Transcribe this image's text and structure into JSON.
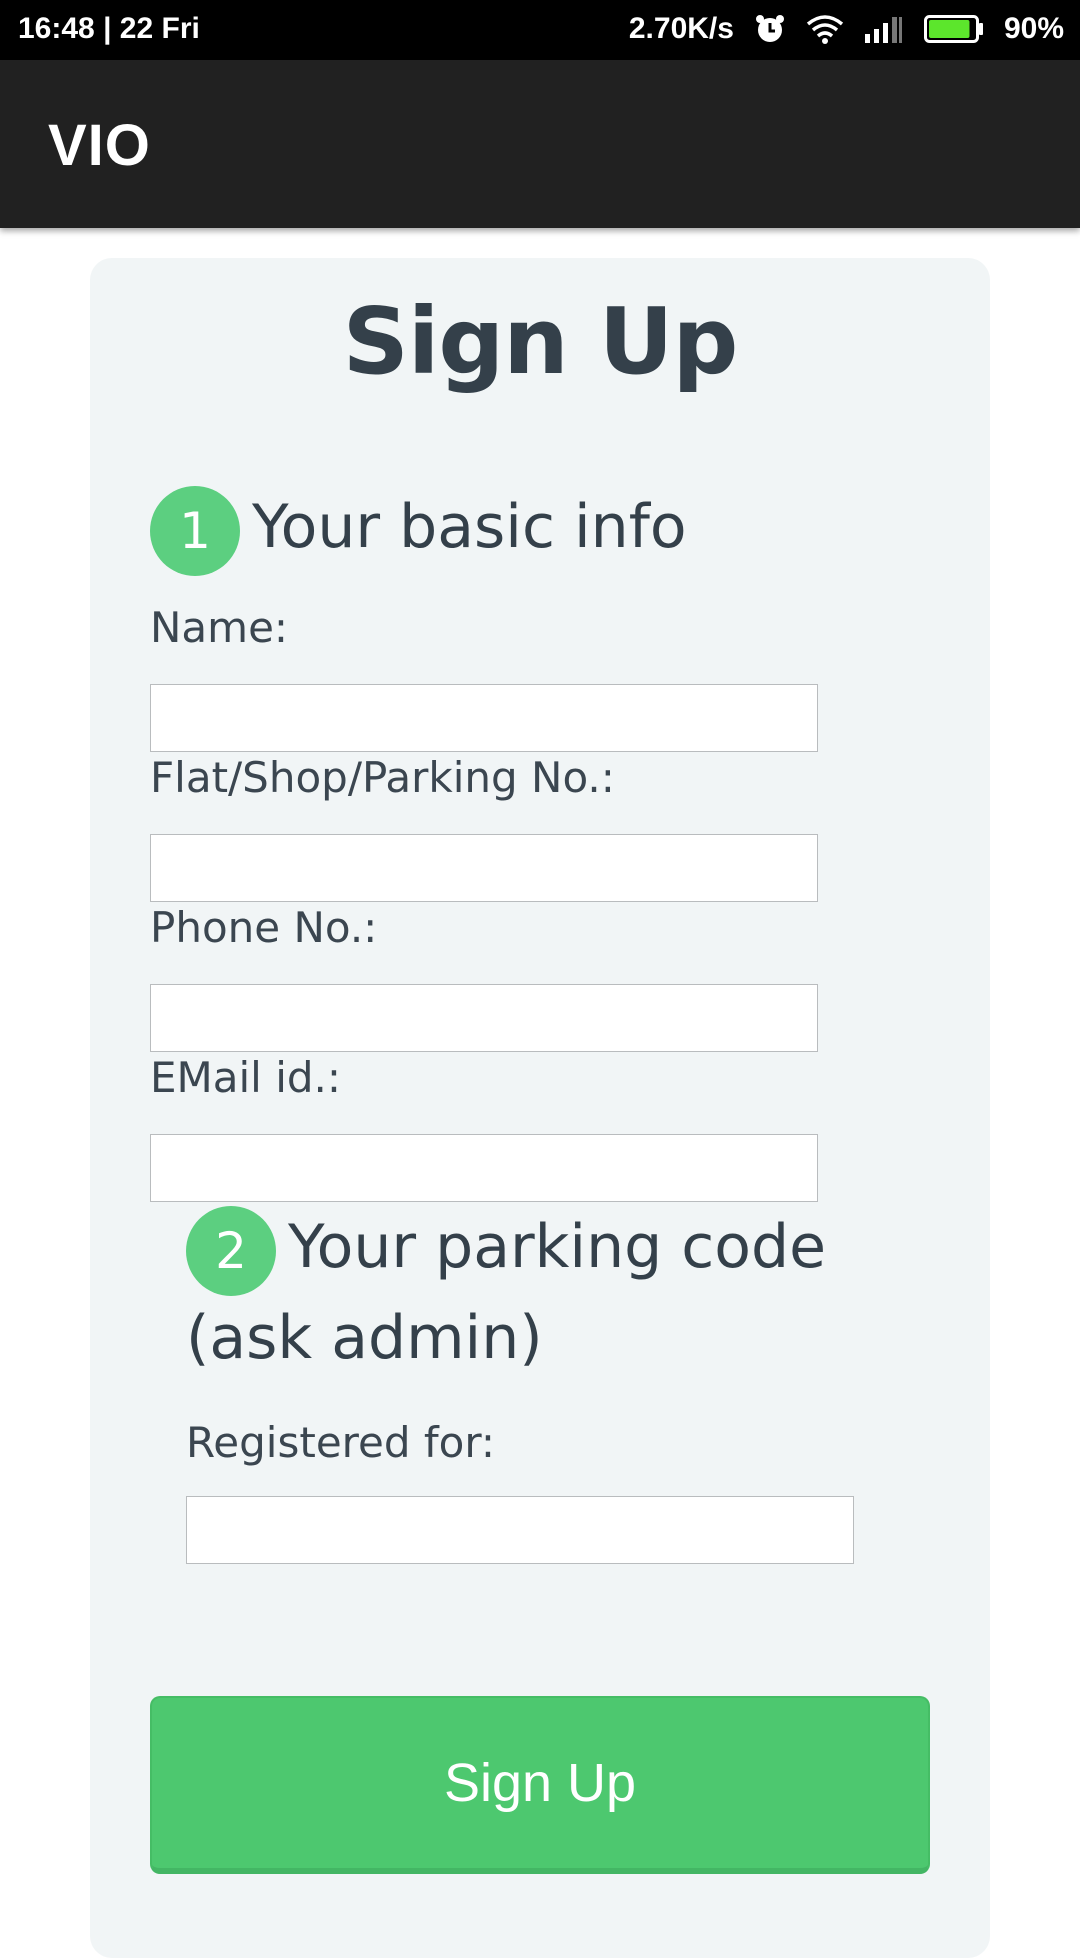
{
  "status_bar": {
    "time_date": "16:48  |  22 Fri",
    "network_speed": "2.70K/s",
    "battery_percent": "90%",
    "battery_level": 0.9,
    "icons": [
      "alarm-icon",
      "wifi-icon",
      "signal-icon",
      "battery-icon"
    ]
  },
  "app_bar": {
    "title": "VIO"
  },
  "form": {
    "title": "Sign Up",
    "step1": {
      "number": "1",
      "title": "Your basic info"
    },
    "fields": [
      {
        "label": "Name:",
        "value": "",
        "placeholder": ""
      },
      {
        "label": "Flat/Shop/Parking No.:",
        "value": "",
        "placeholder": ""
      },
      {
        "label": "Phone No.:",
        "value": "",
        "placeholder": ""
      },
      {
        "label": "EMail id.:",
        "value": "",
        "placeholder": ""
      }
    ],
    "step2": {
      "number": "2",
      "title_line1": "Your parking code",
      "title_line2": "(ask admin)"
    },
    "registered_field": {
      "label": "Registered for:",
      "value": "",
      "placeholder": ""
    },
    "submit_label": "Sign Up"
  },
  "colors": {
    "accent_green": "#4dc86f",
    "badge_green": "#5ccf80",
    "app_bar": "#212121",
    "card_bg": "#f1f5f6",
    "text_dark": "#34404a"
  }
}
